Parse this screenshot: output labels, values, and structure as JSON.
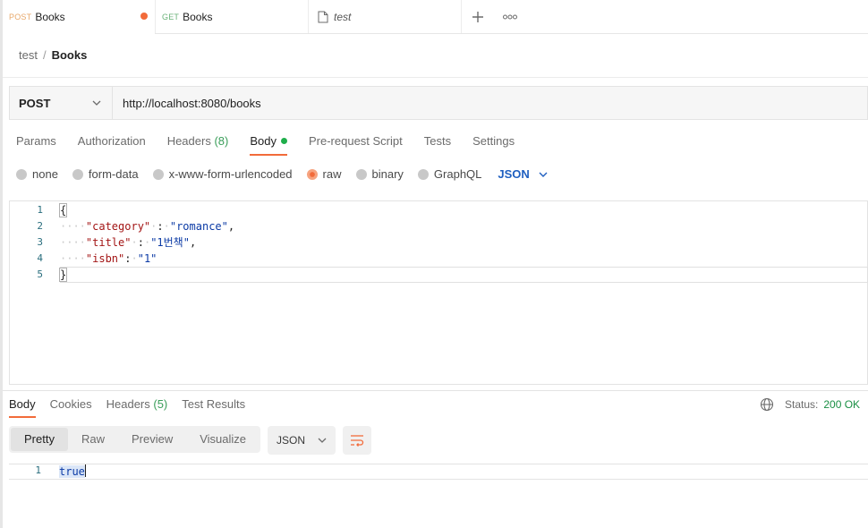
{
  "colors": {
    "accent": "#f26b3a",
    "post": "#e8a86a",
    "get": "#6bb37a",
    "status_ok": "#1a8f44",
    "json_blue": "#1f5fc0"
  },
  "tabs": [
    {
      "method": "POST",
      "title": "Books",
      "unsaved": true
    },
    {
      "method": "GET",
      "title": "Books"
    },
    {
      "icon": "document-icon",
      "title": "test"
    }
  ],
  "tab_actions": {
    "add": "+",
    "more": "ooo"
  },
  "breadcrumb": {
    "collection": "test",
    "separator": "/",
    "request": "Books"
  },
  "request": {
    "method": "POST",
    "url": "http://localhost:8080/books"
  },
  "request_tabs": {
    "params": "Params",
    "authorization": "Authorization",
    "headers": "Headers",
    "headers_count": "(8)",
    "body": "Body",
    "prerequest": "Pre-request Script",
    "tests": "Tests",
    "settings": "Settings"
  },
  "body_types": {
    "none": "none",
    "form_data": "form-data",
    "urlencoded": "x-www-form-urlencoded",
    "raw": "raw",
    "binary": "binary",
    "graphql": "GraphQL",
    "selected": "raw",
    "language": "JSON"
  },
  "editor": {
    "lines": [
      {
        "num": "1",
        "open": "{"
      },
      {
        "num": "2",
        "key": "\"category\"",
        "value": "\"romance\""
      },
      {
        "num": "3",
        "key": "\"title\"",
        "value": "\"1번책\""
      },
      {
        "num": "4",
        "key": "\"isbn\"",
        "value": "\"1\""
      },
      {
        "num": "5",
        "close": "}"
      }
    ]
  },
  "response_tabs": {
    "body": "Body",
    "cookies": "Cookies",
    "headers": "Headers",
    "headers_count": "(5)",
    "test_results": "Test Results"
  },
  "status": {
    "label": "Status:",
    "value": "200 OK"
  },
  "view_modes": {
    "pretty": "Pretty",
    "raw": "Raw",
    "preview": "Preview",
    "visualize": "Visualize",
    "selected": "Pretty"
  },
  "response_format": "JSON",
  "response_body": {
    "line_num": "1",
    "value": "true"
  }
}
